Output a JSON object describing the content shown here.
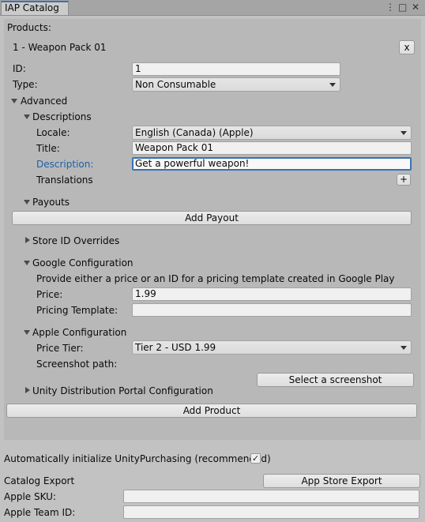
{
  "window": {
    "tab_title": "IAP Catalog",
    "menu_glyph": "⋮",
    "maximize_glyph": "□",
    "close_glyph": "✕"
  },
  "products": {
    "heading": "Products:",
    "item": {
      "header": "1 - Weapon Pack 01",
      "remove_label": "x",
      "id_label": "ID:",
      "id_value": "1",
      "type_label": "Type:",
      "type_value": "Non Consumable",
      "advanced_label": "Advanced",
      "descriptions": {
        "label": "Descriptions",
        "locale_label": "Locale:",
        "locale_value": "English (Canada) (Apple)",
        "title_label": "Title:",
        "title_value": "Weapon Pack 01",
        "description_label": "Description:",
        "description_value": "Get a powerful weapon!",
        "translations_label": "Translations",
        "add_translation_label": "+"
      },
      "payouts": {
        "label": "Payouts",
        "add_payout_label": "Add Payout"
      },
      "store_id_overrides_label": "Store ID Overrides",
      "google": {
        "label": "Google Configuration",
        "hint": "Provide either a price or an ID for a pricing template created in Google Play",
        "price_label": "Price:",
        "price_value": "1.99",
        "pricing_template_label": "Pricing Template:",
        "pricing_template_value": ""
      },
      "apple": {
        "label": "Apple Configuration",
        "price_tier_label": "Price Tier:",
        "price_tier_value": "Tier 2 - USD 1.99",
        "screenshot_label": "Screenshot path:",
        "select_screenshot_label": "Select a screenshot"
      },
      "udp_label": "Unity Distribution Portal Configuration"
    },
    "add_product_label": "Add Product"
  },
  "footer": {
    "auto_init_label": "Automatically initialize UnityPurchasing (recommended)",
    "auto_init_checked": "✓",
    "catalog_export_label": "Catalog Export",
    "app_store_export_label": "App Store Export",
    "apple_sku_label": "Apple SKU:",
    "apple_sku_value": "",
    "apple_team_id_label": "Apple Team ID:",
    "apple_team_id_value": ""
  }
}
